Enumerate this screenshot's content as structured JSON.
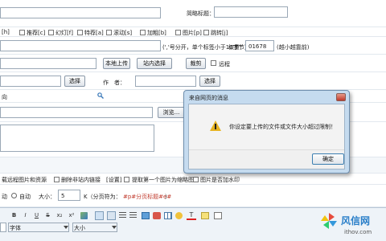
{
  "form": {
    "short_title_label": "简略标题：",
    "flags": [
      "[h]",
      "推荐[c]",
      "幻灯[f]",
      "特荐[a]",
      "滚动[s]",
      "加粗[b]",
      "图片[p]",
      "跳转[j]"
    ],
    "tag_hint": "(','号分开，单个标签小于12字节)",
    "weight_label": "权重：",
    "weight_value": "01678",
    "weight_hint": "(越小越靠前)",
    "upload_local_label": "本地上传",
    "site_select_label": "站内选择",
    "crop_label": "裁剪",
    "remote_label": "远程",
    "select_label_1": "选择",
    "author_label": "作　者：",
    "select_label_2": "选择",
    "source_partial": "向",
    "browse_label": "浏览...",
    "options_text_1": "载远程图片和资源",
    "delete_links_text": "删除非站内链接",
    "settings_link": "[设置]",
    "extract_text": "提取第一个图片为缩略图",
    "watermark_text": "图片是否加水印",
    "paging_prefix": "动",
    "auto_label": "自动",
    "size_label": "大小：",
    "size_value": "5",
    "size_unit": "K（分页符为：",
    "page_marker": "#p#分页标题#e#",
    "page_suffix": "）"
  },
  "editor": {
    "format_buttons": [
      "B",
      "I",
      "U",
      "S",
      "x₂",
      "x²"
    ],
    "font_label": "字体",
    "size_label": "大小",
    "color_accent": "#e8f0f8"
  },
  "dialog": {
    "title": "来自网页的消息",
    "message": "你设定要上传的文件或文件大小超过限制！",
    "ok_label": "确定"
  },
  "watermark": {
    "site_name": "风信网",
    "site_url": "ithov.com"
  }
}
